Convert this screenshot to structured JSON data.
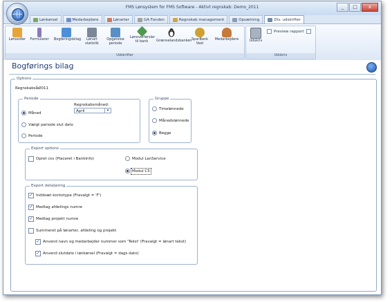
{
  "window": {
    "title": "FMS Lønsystem for FMS Software - Aktivt regnskab: Demo_2011",
    "buttons": [
      "_",
      "□",
      "x"
    ]
  },
  "tabs": [
    {
      "label": "Lønkørsel",
      "color": "#7aa66a"
    },
    {
      "label": "Medarbejdere",
      "color": "#6b8fc6"
    },
    {
      "label": "Lønarter",
      "color": "#c77d5a"
    },
    {
      "label": "GA Fonden",
      "color": "#a0a0a0"
    },
    {
      "label": "Regnskab management",
      "color": "#cba64a"
    },
    {
      "label": "Opsætning",
      "color": "#8b9db5"
    },
    {
      "label": "Div. udskrifter",
      "color": "#6d8ca8"
    }
  ],
  "ribbon": {
    "group1": {
      "label": "Udskrifter",
      "buttons": [
        {
          "label": "Lønsedler",
          "icon": "people-icon",
          "color": "#e6a53a"
        },
        {
          "label": "Formularer",
          "icon": "form-icon",
          "color": "#8a7bb8"
        },
        {
          "label": "Bogføringsbilag",
          "icon": "ledger-icon",
          "color": "#4d8fd6"
        },
        {
          "label": "Lønart statistik",
          "icon": "printer-icon",
          "color": "#7c8798"
        },
        {
          "label": "Opgørelse periode",
          "icon": "document-icon",
          "color": "#5a8fc5"
        },
        {
          "label": "Lønoverførsler til bank",
          "icon": "money-icon",
          "color": "#4e9a4e"
        },
        {
          "label": "Grænselandsbanken",
          "icon": "penguin-icon",
          "color": "#333333"
        },
        {
          "label": "SparBank Vest",
          "icon": "bank-icon",
          "color": "#d0a030"
        },
        {
          "label": "Medarbejdere",
          "icon": "person-icon",
          "color": "#c7793a"
        }
      ]
    },
    "group2": {
      "label": "Udskriv",
      "print_label": "Udskriv",
      "preview_label": "Preview rapport"
    }
  },
  "page": {
    "title": "Bogførings bilag",
    "options_label": "Options",
    "regnskabsaar_label": "Regnskabsår:",
    "regnskabsaar_value": "2011"
  },
  "periode": {
    "title": "Periode",
    "radios": [
      {
        "label": "Måned",
        "selected": true
      },
      {
        "label": "Vælgt periode slut dato",
        "selected": false
      },
      {
        "label": "Periode",
        "selected": false
      }
    ],
    "month_label": "Regnskabsmåned:",
    "month_value": "April"
  },
  "gruppe": {
    "title": "Gruppe",
    "radios": [
      {
        "label": "Timelønnede",
        "selected": false
      },
      {
        "label": "Månedslønnede",
        "selected": false
      },
      {
        "label": "Begge",
        "selected": true
      }
    ]
  },
  "export_options": {
    "title": "Export options",
    "checkbox": {
      "label": "Opret csv (Placeret i BankInfo)",
      "checked": false
    },
    "radios": [
      {
        "label": "Modul LanService",
        "selected": false
      },
      {
        "label": "Modul C5",
        "selected": true
      }
    ]
  },
  "export_detail": {
    "title": "Export detaljering",
    "checks": [
      {
        "label": "Inddsæt kontotype  (Fravalgt = 'F')",
        "checked": true
      },
      {
        "label": "Medtag afdelings numre",
        "checked": true
      },
      {
        "label": "Medtag projekt numre",
        "checked": true
      },
      {
        "label": "Summeret på lønarter, afdeling og projekt",
        "checked": false
      },
      {
        "label": "Anvend navn og medarbejder nummer som 'Tekst' (Fravalgt = lønart tekst)",
        "checked": true
      },
      {
        "label": "Anvend slutdato i lønkørsel (Fravalgt = dags dato)",
        "checked": true
      }
    ]
  }
}
